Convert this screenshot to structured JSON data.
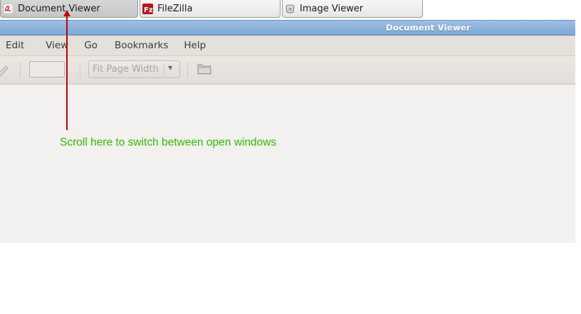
{
  "taskbar": {
    "tasks": [
      {
        "label": "Document Viewer",
        "icon": "document-viewer-icon",
        "active": true
      },
      {
        "label": "FileZilla",
        "icon": "filezilla-icon",
        "active": false
      },
      {
        "label": "Image Viewer",
        "icon": "image-viewer-icon",
        "active": false
      }
    ]
  },
  "window": {
    "title": "Document Viewer",
    "menu": [
      "Edit",
      "View",
      "Go",
      "Bookmarks",
      "Help"
    ],
    "toolbar": {
      "page_value": "",
      "zoom_label": "Fit Page Width",
      "icons": [
        "pencil-icon",
        "folder-icon",
        "dropdown-arrow-icon"
      ]
    }
  },
  "annotation": {
    "text": "Scroll here to switch between open windows",
    "colors": {
      "arrow": "#c40000",
      "text": "#2fbf00"
    }
  },
  "colors": {
    "titlebar": "#87afd9",
    "menubar": "#e4e0da",
    "window_bg": "#f2f1f0"
  }
}
